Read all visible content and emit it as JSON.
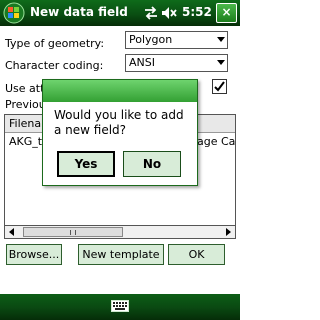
{
  "titlebar": {
    "title": "New data field",
    "time": "5:52",
    "close_label": "×"
  },
  "form": {
    "geometry_label": "Type of geometry:",
    "geometry_value": "Polygon",
    "coding_label": "Character coding:",
    "coding_value": "ANSI",
    "use_attr_label": "Use attr",
    "use_attr_checked": true,
    "previous_label": "Previous"
  },
  "list": {
    "columns": [
      "Filenam",
      ""
    ],
    "rows": [
      [
        "AKG_te",
        "age Ca"
      ]
    ]
  },
  "buttons": {
    "browse": "Browse...",
    "new_template": "New template",
    "ok": "OK"
  },
  "dialog": {
    "message": "Would you like to add a new field?",
    "yes": "Yes",
    "no": "No"
  },
  "icons": {
    "start": "windows-flag-icon",
    "sync": "sync-arrows-icon",
    "volume": "speaker-muted-icon",
    "keyboard": "keyboard-icon"
  },
  "colors": {
    "titlebar": "#0a4e12",
    "dialog_header": "#4cba4c",
    "button_bg": "#d8ecd8"
  }
}
